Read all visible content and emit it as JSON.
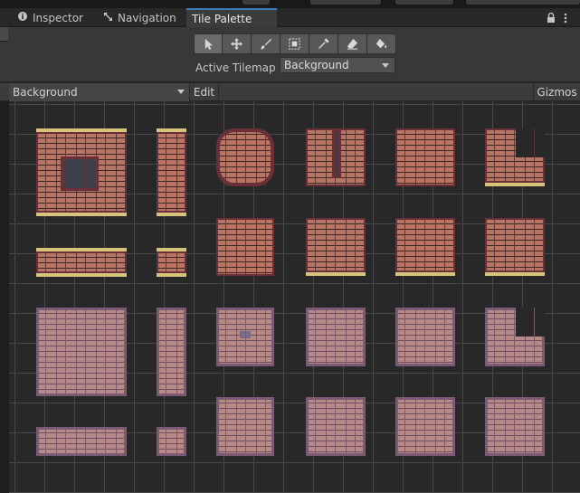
{
  "tabs": [
    {
      "label": "Inspector",
      "icon": "info-icon",
      "active": false
    },
    {
      "label": "Navigation",
      "icon": "navigation-icon",
      "active": false
    },
    {
      "label": "Tile Palette",
      "icon": "",
      "active": true
    }
  ],
  "toolbar": {
    "tools": [
      {
        "name": "select-tool",
        "icon": "arrow-icon"
      },
      {
        "name": "move-tool",
        "icon": "move-icon"
      },
      {
        "name": "paint-tool",
        "icon": "brush-icon"
      },
      {
        "name": "box-fill-tool",
        "icon": "box-fill-icon"
      },
      {
        "name": "pick-tool",
        "icon": "eyedropper-icon"
      },
      {
        "name": "erase-tool",
        "icon": "eraser-icon"
      },
      {
        "name": "fill-tool",
        "icon": "bucket-icon"
      }
    ],
    "active_tilemap_label": "Active Tilemap",
    "active_tilemap_value": "Background"
  },
  "palette_bar": {
    "palette_value": "Background",
    "edit_label": "Edit",
    "gizmos_label": "Gizmos"
  },
  "colors": {
    "accent": "#3a79bb",
    "brick_red": "#b97564",
    "brick_pink": "#b88a87",
    "gold_trim": "#d6c47a"
  }
}
